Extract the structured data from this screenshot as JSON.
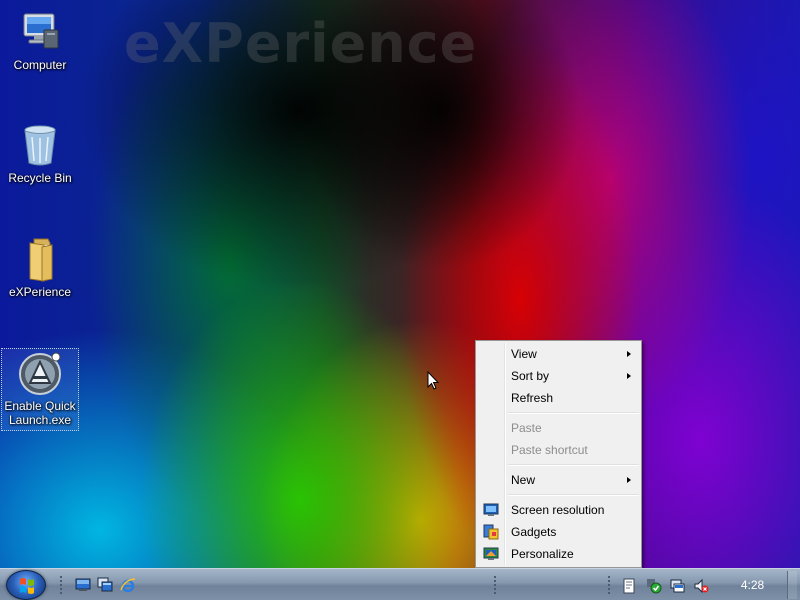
{
  "desktop": {
    "watermark_text": "eXPerience",
    "icons": [
      {
        "label": "Computer",
        "icon": "computer-icon"
      },
      {
        "label": "Recycle Bin",
        "icon": "recycle-bin-icon"
      },
      {
        "label": "eXPerience",
        "icon": "folder-icon"
      },
      {
        "label": "Enable Quick Launch.exe",
        "icon": "application-icon",
        "selected": true
      }
    ]
  },
  "context_menu": {
    "items": [
      {
        "label": "View",
        "submenu": true,
        "enabled": true
      },
      {
        "label": "Sort by",
        "submenu": true,
        "enabled": true
      },
      {
        "label": "Refresh",
        "submenu": false,
        "enabled": true
      },
      {
        "label": "Paste",
        "submenu": false,
        "enabled": false
      },
      {
        "label": "Paste shortcut",
        "submenu": false,
        "enabled": false
      },
      {
        "label": "New",
        "submenu": true,
        "enabled": true
      },
      {
        "label": "Screen resolution",
        "submenu": false,
        "enabled": true,
        "icon": "screen-resolution-icon"
      },
      {
        "label": "Gadgets",
        "submenu": false,
        "enabled": true,
        "icon": "gadgets-icon"
      },
      {
        "label": "Personalize",
        "submenu": false,
        "enabled": true,
        "icon": "personalize-icon"
      }
    ]
  },
  "taskbar": {
    "start_icon": "windows-logo-icon",
    "quick_launch": [
      "show-desktop-icon",
      "switch-windows-icon",
      "internet-explorer-icon"
    ],
    "tray": [
      "document-icon",
      "security-shield-icon",
      "network-icon",
      "volume-muted-icon"
    ],
    "clock": "4:28"
  },
  "colors": {
    "menu_background": "#f0f0f0",
    "menu_disabled_text": "#8d8d8d",
    "taskbar": "#8497ad"
  }
}
